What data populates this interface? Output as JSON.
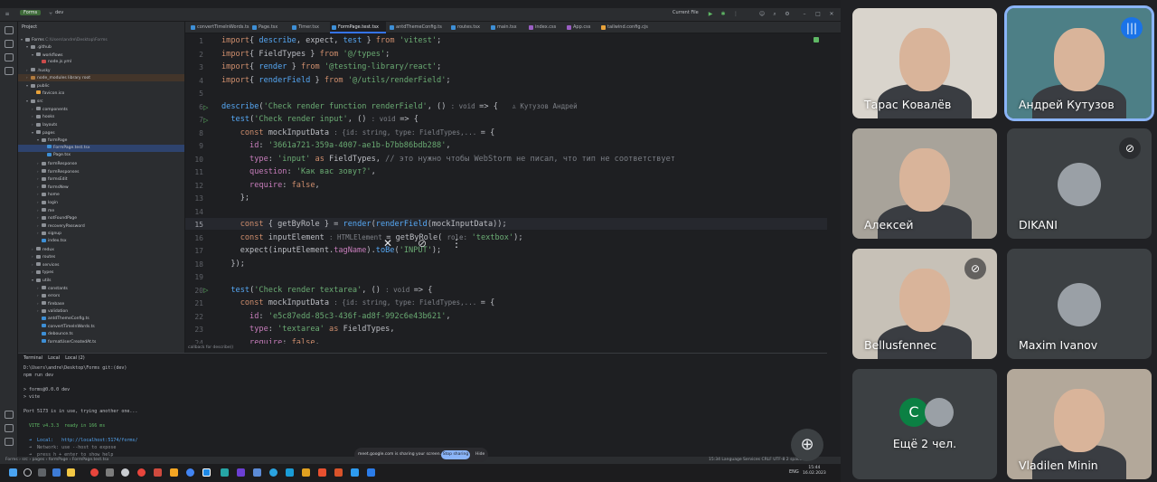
{
  "ide": {
    "project_name": "Forms",
    "branch": "dev",
    "run_config": "Current File",
    "project_label": "Project",
    "project_root": "Forms",
    "project_root_path": "C:\\Users\\andre\\Desktop\\Forms",
    "tree": [
      {
        "label": ".github",
        "indent": 1,
        "arrow": "▾",
        "color": "#8c9096"
      },
      {
        "label": "workflows",
        "indent": 2,
        "arrow": "▾",
        "color": "#8c9096"
      },
      {
        "label": "node.js.yml",
        "indent": 3,
        "arrow": "",
        "color": "#cb4b4b"
      },
      {
        "label": ".husky",
        "indent": 1,
        "arrow": "›",
        "color": "#8c9096"
      },
      {
        "label": "node_modules  library root",
        "indent": 1,
        "arrow": "›",
        "color": "#b07b3f",
        "style": "hl"
      },
      {
        "label": "public",
        "indent": 1,
        "arrow": "▾",
        "color": "#8c9096"
      },
      {
        "label": "favicon.ico",
        "indent": 2,
        "arrow": "",
        "color": "#e8a23a"
      },
      {
        "label": "src",
        "indent": 1,
        "arrow": "▾",
        "color": "#8c9096"
      },
      {
        "label": "components",
        "indent": 2,
        "arrow": "›",
        "color": "#8c9096"
      },
      {
        "label": "hooks",
        "indent": 2,
        "arrow": "›",
        "color": "#8c9096"
      },
      {
        "label": "layouts",
        "indent": 2,
        "arrow": "›",
        "color": "#8c9096"
      },
      {
        "label": "pages",
        "indent": 2,
        "arrow": "▾",
        "color": "#8c9096"
      },
      {
        "label": "formPage",
        "indent": 3,
        "arrow": "▾",
        "color": "#8c9096"
      },
      {
        "label": "FormPage.test.tsx",
        "indent": 4,
        "arrow": "",
        "color": "#3d8fd6",
        "style": "sel"
      },
      {
        "label": "Page.tsx",
        "indent": 4,
        "arrow": "",
        "color": "#3d8fd6"
      },
      {
        "label": "formResponse",
        "indent": 3,
        "arrow": "›",
        "color": "#8c9096"
      },
      {
        "label": "formResponses",
        "indent": 3,
        "arrow": "›",
        "color": "#8c9096"
      },
      {
        "label": "formsEdit",
        "indent": 3,
        "arrow": "›",
        "color": "#8c9096"
      },
      {
        "label": "formsNew",
        "indent": 3,
        "arrow": "›",
        "color": "#8c9096"
      },
      {
        "label": "home",
        "indent": 3,
        "arrow": "›",
        "color": "#8c9096"
      },
      {
        "label": "login",
        "indent": 3,
        "arrow": "›",
        "color": "#8c9096"
      },
      {
        "label": "me",
        "indent": 3,
        "arrow": "›",
        "color": "#8c9096"
      },
      {
        "label": "notFoundPage",
        "indent": 3,
        "arrow": "›",
        "color": "#8c9096"
      },
      {
        "label": "recoveryPassword",
        "indent": 3,
        "arrow": "›",
        "color": "#8c9096"
      },
      {
        "label": "signup",
        "indent": 3,
        "arrow": "›",
        "color": "#8c9096"
      },
      {
        "label": "index.tsx",
        "indent": 3,
        "arrow": "",
        "color": "#3d8fd6"
      },
      {
        "label": "redux",
        "indent": 2,
        "arrow": "›",
        "color": "#8c9096"
      },
      {
        "label": "routes",
        "indent": 2,
        "arrow": "›",
        "color": "#8c9096"
      },
      {
        "label": "services",
        "indent": 2,
        "arrow": "›",
        "color": "#8c9096"
      },
      {
        "label": "types",
        "indent": 2,
        "arrow": "›",
        "color": "#8c9096"
      },
      {
        "label": "utils",
        "indent": 2,
        "arrow": "▾",
        "color": "#8c9096"
      },
      {
        "label": "constants",
        "indent": 3,
        "arrow": "›",
        "color": "#8c9096"
      },
      {
        "label": "errors",
        "indent": 3,
        "arrow": "›",
        "color": "#8c9096"
      },
      {
        "label": "firebase",
        "indent": 3,
        "arrow": "›",
        "color": "#8c9096"
      },
      {
        "label": "validation",
        "indent": 3,
        "arrow": "›",
        "color": "#8c9096"
      },
      {
        "label": "antdThemeConfig.ts",
        "indent": 3,
        "arrow": "",
        "color": "#3d8fd6"
      },
      {
        "label": "convertTimeInWords.ts",
        "indent": 3,
        "arrow": "",
        "color": "#3d8fd6"
      },
      {
        "label": "debounce.ts",
        "indent": 3,
        "arrow": "",
        "color": "#3d8fd6"
      },
      {
        "label": "formatUserCreatedAt.ts",
        "indent": 3,
        "arrow": "",
        "color": "#3d8fd6"
      }
    ],
    "tabs": [
      {
        "label": "convertTimeInWords.ts",
        "color": "#3d8fd6"
      },
      {
        "label": "Page.tsx",
        "color": "#3d8fd6"
      },
      {
        "label": "Timer.tsx",
        "color": "#3d8fd6"
      },
      {
        "label": "FormPage.test.tsx",
        "color": "#3d8fd6",
        "active": true
      },
      {
        "label": "antdThemeConfig.ts",
        "color": "#3d8fd6"
      },
      {
        "label": "routes.tsx",
        "color": "#3d8fd6"
      },
      {
        "label": "main.tsx",
        "color": "#3d8fd6"
      },
      {
        "label": "index.css",
        "color": "#9b5fc4"
      },
      {
        "label": "App.css",
        "color": "#9b5fc4"
      },
      {
        "label": "tailwind.config.cjs",
        "color": "#e8a23a"
      }
    ],
    "code_lines": [
      {
        "n": "1",
        "html_key": "l1"
      },
      {
        "n": "2",
        "html_key": "l2"
      },
      {
        "n": "3",
        "html_key": "l3"
      },
      {
        "n": "4",
        "html_key": "l4"
      },
      {
        "n": "5",
        "html_key": "l5"
      },
      {
        "n": "6",
        "html_key": "l6"
      },
      {
        "n": "7",
        "html_key": "l7"
      },
      {
        "n": "8",
        "html_key": "l8"
      },
      {
        "n": "9",
        "html_key": "l9"
      },
      {
        "n": "10",
        "html_key": "l10"
      },
      {
        "n": "11",
        "html_key": "l11"
      },
      {
        "n": "12",
        "html_key": "l12"
      },
      {
        "n": "13",
        "html_key": "l13"
      },
      {
        "n": "14",
        "html_key": "l14"
      },
      {
        "n": "15",
        "html_key": "l15"
      },
      {
        "n": "16",
        "html_key": "l16"
      },
      {
        "n": "17",
        "html_key": "l17"
      },
      {
        "n": "18",
        "html_key": "l18"
      },
      {
        "n": "19",
        "html_key": "l19"
      },
      {
        "n": "20",
        "html_key": "l20"
      },
      {
        "n": "21",
        "html_key": "l21"
      },
      {
        "n": "22",
        "html_key": "l22"
      },
      {
        "n": "23",
        "html_key": "l23"
      },
      {
        "n": "24",
        "html_key": "l24"
      }
    ],
    "code": {
      "l1": [
        [
          "kw",
          "import"
        ],
        [
          "",
          "{ "
        ],
        [
          "fn",
          "describe"
        ],
        [
          "",
          ", expect, "
        ],
        [
          "fn",
          "test"
        ],
        [
          "",
          " } "
        ],
        [
          "kw",
          "from"
        ],
        [
          "",
          " "
        ],
        [
          "str",
          "'vitest'"
        ],
        [
          "",
          ";"
        ]
      ],
      "l2": [
        [
          "kw",
          "import"
        ],
        [
          "",
          "{ FieldTypes } "
        ],
        [
          "kw",
          "from"
        ],
        [
          "",
          " "
        ],
        [
          "str",
          "'@/types'"
        ],
        [
          "",
          ";"
        ]
      ],
      "l3": [
        [
          "kw",
          "import"
        ],
        [
          "",
          "{ "
        ],
        [
          "fn",
          "render"
        ],
        [
          "",
          " } "
        ],
        [
          "kw",
          "from"
        ],
        [
          "",
          " "
        ],
        [
          "str",
          "'@testing-library/react'"
        ],
        [
          "",
          ";"
        ]
      ],
      "l4": [
        [
          "kw",
          "import"
        ],
        [
          "",
          "{ "
        ],
        [
          "fn",
          "renderField"
        ],
        [
          "",
          " } "
        ],
        [
          "kw",
          "from"
        ],
        [
          "",
          " "
        ],
        [
          "str",
          "'@/utils/renderField'"
        ],
        [
          "",
          ";"
        ]
      ],
      "l5": [],
      "l6": [
        [
          "fn",
          "describe"
        ],
        [
          "",
          "("
        ],
        [
          "str",
          "'Check render function renderField'"
        ],
        [
          "",
          ", () "
        ],
        [
          "hint",
          ": void "
        ],
        [
          "",
          "=> {   "
        ],
        [
          "hint",
          "♙ Кутузов Андрей"
        ]
      ],
      "l7": [
        [
          "",
          "  "
        ],
        [
          "fn",
          "test"
        ],
        [
          "",
          "("
        ],
        [
          "str",
          "'Check render input'"
        ],
        [
          "",
          ", () "
        ],
        [
          "hint",
          ": void "
        ],
        [
          "",
          "=> {"
        ]
      ],
      "l8": [
        [
          "",
          "    "
        ],
        [
          "kw",
          "const"
        ],
        [
          "",
          " mockInputData "
        ],
        [
          "hint",
          ": {id: string, type: FieldTypes,... "
        ],
        [
          "",
          "= {"
        ]
      ],
      "l9": [
        [
          "",
          "      "
        ],
        [
          "pr",
          "id"
        ],
        [
          "",
          ": "
        ],
        [
          "str",
          "'3661a721-359a-4007-ae1b-b7bb86bdb288'"
        ],
        [
          "",
          ","
        ]
      ],
      "l10": [
        [
          "",
          "      "
        ],
        [
          "pr",
          "type"
        ],
        [
          "",
          ": "
        ],
        [
          "str",
          "'input'"
        ],
        [
          "",
          " "
        ],
        [
          "kw",
          "as"
        ],
        [
          "",
          " FieldTypes, "
        ],
        [
          "cm",
          "// это нужно чтобы WebStorm не писал, что тип не соответствует"
        ]
      ],
      "l11": [
        [
          "",
          "      "
        ],
        [
          "pr",
          "question"
        ],
        [
          "",
          ": "
        ],
        [
          "str",
          "'Как вас зовут?'"
        ],
        [
          "",
          ","
        ]
      ],
      "l12": [
        [
          "",
          "      "
        ],
        [
          "pr",
          "require"
        ],
        [
          "",
          ": "
        ],
        [
          "kw",
          "false"
        ],
        [
          "",
          ","
        ]
      ],
      "l13": [
        [
          "",
          "    };"
        ]
      ],
      "l14": [],
      "l15": [
        [
          "",
          "    "
        ],
        [
          "kw",
          "const"
        ],
        [
          "",
          " { getByRole } = "
        ],
        [
          "fn",
          "render"
        ],
        [
          "",
          "("
        ],
        [
          "fn",
          "renderField"
        ],
        [
          "",
          "(mockInputData));"
        ]
      ],
      "l16": [
        [
          "",
          "    "
        ],
        [
          "kw",
          "const"
        ],
        [
          "",
          " inputElement "
        ],
        [
          "hint",
          ": HTMLElement "
        ],
        [
          "",
          "= getByRole( "
        ],
        [
          "hint",
          "role: "
        ],
        [
          "str",
          "'textbox'"
        ],
        [
          "",
          ");"
        ]
      ],
      "l17": [
        [
          "",
          "    expect(inputElement."
        ],
        [
          "pr",
          "tagName"
        ],
        [
          "",
          ")."
        ],
        [
          "fn",
          "toBe"
        ],
        [
          "",
          "("
        ],
        [
          "str",
          "'INPUT'"
        ],
        [
          "",
          ");"
        ]
      ],
      "l18": [
        [
          "",
          "  });"
        ]
      ],
      "l19": [],
      "l20": [
        [
          "",
          "  "
        ],
        [
          "fn",
          "test"
        ],
        [
          "",
          "("
        ],
        [
          "str",
          "'Check render textarea'"
        ],
        [
          "",
          ", () "
        ],
        [
          "hint",
          ": void "
        ],
        [
          "",
          "=> {"
        ]
      ],
      "l21": [
        [
          "",
          "    "
        ],
        [
          "kw",
          "const"
        ],
        [
          "",
          " mockInputData "
        ],
        [
          "hint",
          ": {id: string, type: FieldTypes,... "
        ],
        [
          "",
          "= {"
        ]
      ],
      "l22": [
        [
          "",
          "      "
        ],
        [
          "pr",
          "id"
        ],
        [
          "",
          ": "
        ],
        [
          "str",
          "'e5c87edd-85c3-436f-ad8f-992c6e43b621'"
        ],
        [
          "",
          ","
        ]
      ],
      "l23": [
        [
          "",
          "      "
        ],
        [
          "pr",
          "type"
        ],
        [
          "",
          ": "
        ],
        [
          "str",
          "'textarea'"
        ],
        [
          "",
          " "
        ],
        [
          "kw",
          "as"
        ],
        [
          "",
          " FieldTypes,"
        ]
      ],
      "l24": [
        [
          "",
          "      "
        ],
        [
          "pr",
          "require"
        ],
        [
          "",
          ": "
        ],
        [
          "kw",
          "false"
        ],
        [
          "",
          ","
        ]
      ]
    },
    "editor_breadcrumb": "callback for describe()",
    "terminal": {
      "tabs": [
        "Terminal",
        "Local",
        "Local (2)"
      ],
      "lines": [
        "D:\\Users\\andre\\Desktop\\Forms git:(dev)",
        "npm run dev",
        "",
        "> forms@0.0.0 dev",
        "> vite",
        "",
        "Port 5173 is in use, trying another one...",
        "",
        "  VITE v4.3.3  ready in 166 ms",
        "",
        "  ➜  Local:   http://localhost:5174/forms/",
        "  ➜  Network: use --host to expose",
        "  ➜  press h + enter to show help"
      ]
    },
    "status_path": "Forms › src › pages › formPage › FormPage.test.tsx",
    "status_right": "15:34   Language Services   CRLF   UTF-8   2 spaces",
    "share_text": "meet.google.com is sharing your screen.",
    "stop_sharing": "Stop sharing",
    "hide": "Hide",
    "tray_lang": "ENG",
    "tray_time": "15:44",
    "tray_date": "16.02.2023"
  },
  "meet": {
    "participants": [
      {
        "name": "Тарас Ковалёв",
        "kind": "video",
        "bg": "#d9d4cc",
        "muted": false
      },
      {
        "name": "Андрей Кутузов",
        "kind": "video",
        "bg": "#4d7f86",
        "speaking": true
      },
      {
        "name": "Алексей",
        "kind": "video",
        "bg": "#a8a39a",
        "muted": false
      },
      {
        "name": "DIKANI",
        "kind": "avatar",
        "bg": "#3c4043",
        "muted": true
      },
      {
        "name": "Bellusfennec",
        "kind": "video",
        "bg": "#c7c1b7",
        "muted": true
      },
      {
        "name": "Maxim Ivanov",
        "kind": "avatar",
        "bg": "#3c4043",
        "muted": false
      },
      {
        "name": "Ещё 2 чел.",
        "kind": "more",
        "bg": "#3c4043",
        "initial": "С"
      },
      {
        "name": "Vladilen Minin",
        "kind": "video",
        "bg": "#b3a89a",
        "muted": false
      }
    ]
  }
}
